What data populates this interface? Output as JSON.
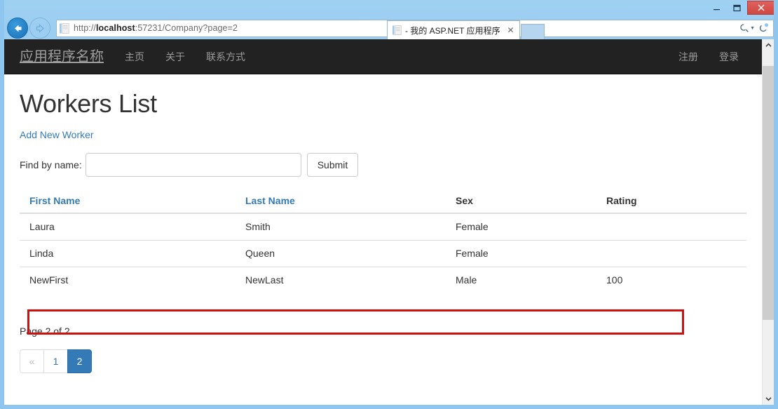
{
  "browser": {
    "url": "http://localhost:57231/Company?page=2",
    "url_bold": "localhost",
    "url_prefix": "http://",
    "url_suffix": ":57231/Company?page=2",
    "back_icon": "back-arrow-icon",
    "forward_icon": "forward-arrow-icon",
    "search_icon": "search-magnifier-icon",
    "refresh_icon": "refresh-icon",
    "home_icon": "home-icon",
    "favorites_icon": "star-icon",
    "settings_icon": "gear-icon",
    "tab": {
      "title": "- 我的 ASP.NET 应用程序",
      "favicon": "page-icon",
      "close_label": "✕"
    },
    "new_tab_label": "",
    "window_controls": {
      "minimize": "minimize-icon",
      "maximize": "maximize-icon",
      "close": "close-icon"
    }
  },
  "navbar": {
    "brand": "应用程序名称",
    "left_items": [
      {
        "label": "主页"
      },
      {
        "label": "关于"
      },
      {
        "label": "联系方式"
      }
    ],
    "right_items": [
      {
        "label": "注册"
      },
      {
        "label": "登录"
      }
    ]
  },
  "main": {
    "title": "Workers List",
    "add_link": "Add New Worker",
    "find": {
      "label": "Find by name:",
      "value": "",
      "placeholder": "",
      "submit_label": "Submit"
    },
    "table": {
      "headers": [
        {
          "label": "First Name",
          "link": true
        },
        {
          "label": "Last Name",
          "link": true
        },
        {
          "label": "Sex",
          "link": false
        },
        {
          "label": "Rating",
          "link": false
        }
      ],
      "rows": [
        {
          "first_name": "Laura",
          "last_name": "Smith",
          "sex": "Female",
          "rating": ""
        },
        {
          "first_name": "Linda",
          "last_name": "Queen",
          "sex": "Female",
          "rating": ""
        },
        {
          "first_name": "NewFirst",
          "last_name": "NewLast",
          "sex": "Male",
          "rating": "100"
        }
      ],
      "highlighted_row_index": 2
    },
    "page_info": "Page 2 of 2",
    "pagination": [
      {
        "label": "«",
        "active": false,
        "disabled": true
      },
      {
        "label": "1",
        "active": false,
        "disabled": false
      },
      {
        "label": "2",
        "active": true,
        "disabled": false
      }
    ]
  },
  "colors": {
    "navbar_bg": "#222222",
    "navbar_text": "#9d9d9d",
    "link": "#337ab7",
    "active_page_bg": "#337ab7",
    "highlight_box": "#cc1111",
    "chrome_blue": "#8ec6ef",
    "close_button": "#d9534f"
  }
}
